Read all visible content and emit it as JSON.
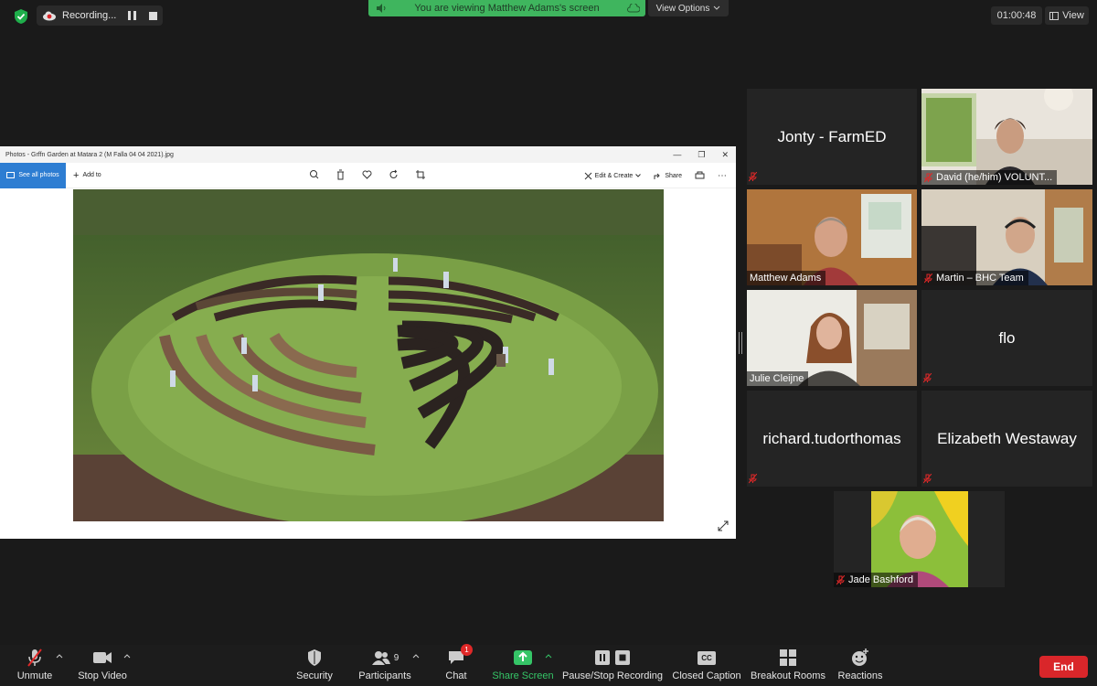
{
  "top": {
    "recording_label": "Recording...",
    "viewing_banner": "You are viewing Matthew Adams's screen",
    "view_options": "View Options",
    "timer": "01:00:48",
    "view_label": "View"
  },
  "photos_app": {
    "title": "Photos - Grffn Garden at Matara 2 (M Falla 04 04 2021).jpg",
    "see_all": "See all photos",
    "add_to": "Add to",
    "edit_create": "Edit & Create",
    "share": "Share"
  },
  "participants": [
    {
      "name": "Jonty - FarmED",
      "muted": true,
      "video": false
    },
    {
      "name": "David (he/him) VOLUNT...",
      "muted": true,
      "video": true
    },
    {
      "name": "Matthew Adams",
      "muted": false,
      "video": true,
      "active_speaker": true
    },
    {
      "name": "Martin – BHC Team",
      "muted": true,
      "video": true
    },
    {
      "name": "Julie Cleijne",
      "muted": false,
      "video": true
    },
    {
      "name": "flo",
      "muted": true,
      "video": false
    },
    {
      "name": "richard.tudorthomas",
      "muted": true,
      "video": false
    },
    {
      "name": "Elizabeth Westaway",
      "muted": true,
      "video": false
    },
    {
      "name": "Jade Bashford",
      "muted": true,
      "video": true
    }
  ],
  "toolbar": {
    "unmute": "Unmute",
    "stop_video": "Stop Video",
    "security": "Security",
    "participants": "Participants",
    "participants_count": "9",
    "chat": "Chat",
    "chat_badge": "1",
    "share_screen": "Share Screen",
    "record": "Pause/Stop Recording",
    "closed_caption": "Closed Caption",
    "closed_caption_icon": "CC",
    "breakout": "Breakout Rooms",
    "reactions": "Reactions",
    "end": "End"
  },
  "colors": {
    "accent_green": "#35c567",
    "banner_green": "#3fb55e",
    "end_red": "#d9262a",
    "active_speaker": "#b7e07a"
  }
}
